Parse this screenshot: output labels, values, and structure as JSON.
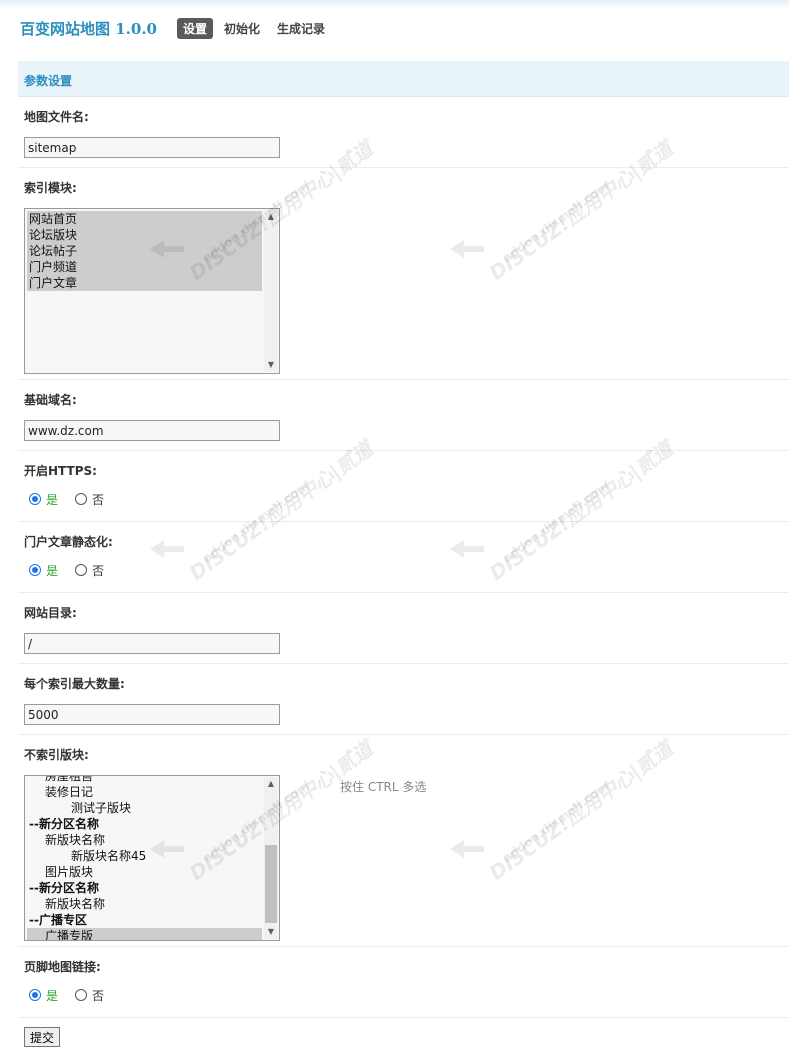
{
  "header": {
    "title": "百变网站地图 1.0.0",
    "tabs": [
      {
        "label": "设置",
        "active": true
      },
      {
        "label": "初始化",
        "active": false
      },
      {
        "label": "生成记录",
        "active": false
      }
    ]
  },
  "section": {
    "title": "参数设置"
  },
  "form": {
    "sitemap_filename": {
      "label": "地图文件名:",
      "value": "sitemap"
    },
    "index_modules": {
      "label": "索引模块:",
      "options": [
        "网站首页",
        "论坛版块",
        "论坛帖子",
        "门户频道",
        "门户文章"
      ],
      "selected": [
        "网站首页",
        "论坛版块",
        "论坛帖子",
        "门户频道",
        "门户文章"
      ]
    },
    "base_domain": {
      "label": "基础域名:",
      "value": "www.dz.com"
    },
    "enable_https": {
      "label": "开启HTTPS:",
      "yes": "是",
      "no": "否",
      "value": "是"
    },
    "portal_static": {
      "label": "门户文章静态化:",
      "yes": "是",
      "no": "否",
      "value": "是"
    },
    "site_dir": {
      "label": "网站目录:",
      "value": "/"
    },
    "max_per_index": {
      "label": "每个索引最大数量:",
      "value": "5000"
    },
    "exclude_forums": {
      "label": "不索引版块:",
      "hint": "按住 CTRL 多选",
      "visible_options": [
        {
          "text": "房屋租售",
          "level": 1,
          "selected": false
        },
        {
          "text": "装修日记",
          "level": 1,
          "selected": false
        },
        {
          "text": "测试子版块",
          "level": 2,
          "selected": false
        },
        {
          "text": "--新分区名称",
          "level": 0,
          "selected": false
        },
        {
          "text": "新版块名称",
          "level": 1,
          "selected": false
        },
        {
          "text": "新版块名称45",
          "level": 2,
          "selected": false
        },
        {
          "text": "图片版块",
          "level": 1,
          "selected": false
        },
        {
          "text": "--新分区名称",
          "level": 0,
          "selected": false
        },
        {
          "text": "新版块名称",
          "level": 1,
          "selected": false
        },
        {
          "text": "--广播专区",
          "level": 0,
          "selected": false
        },
        {
          "text": "广播专版",
          "level": 1,
          "selected": true
        }
      ]
    },
    "footer_link": {
      "label": "页脚地图链接:",
      "yes": "是",
      "no": "否",
      "value": "是"
    },
    "submit_label": "提交"
  },
  "watermark": {
    "brand": "DISCUZ!应用中心|贰道",
    "url": "addon.dismall.com"
  }
}
